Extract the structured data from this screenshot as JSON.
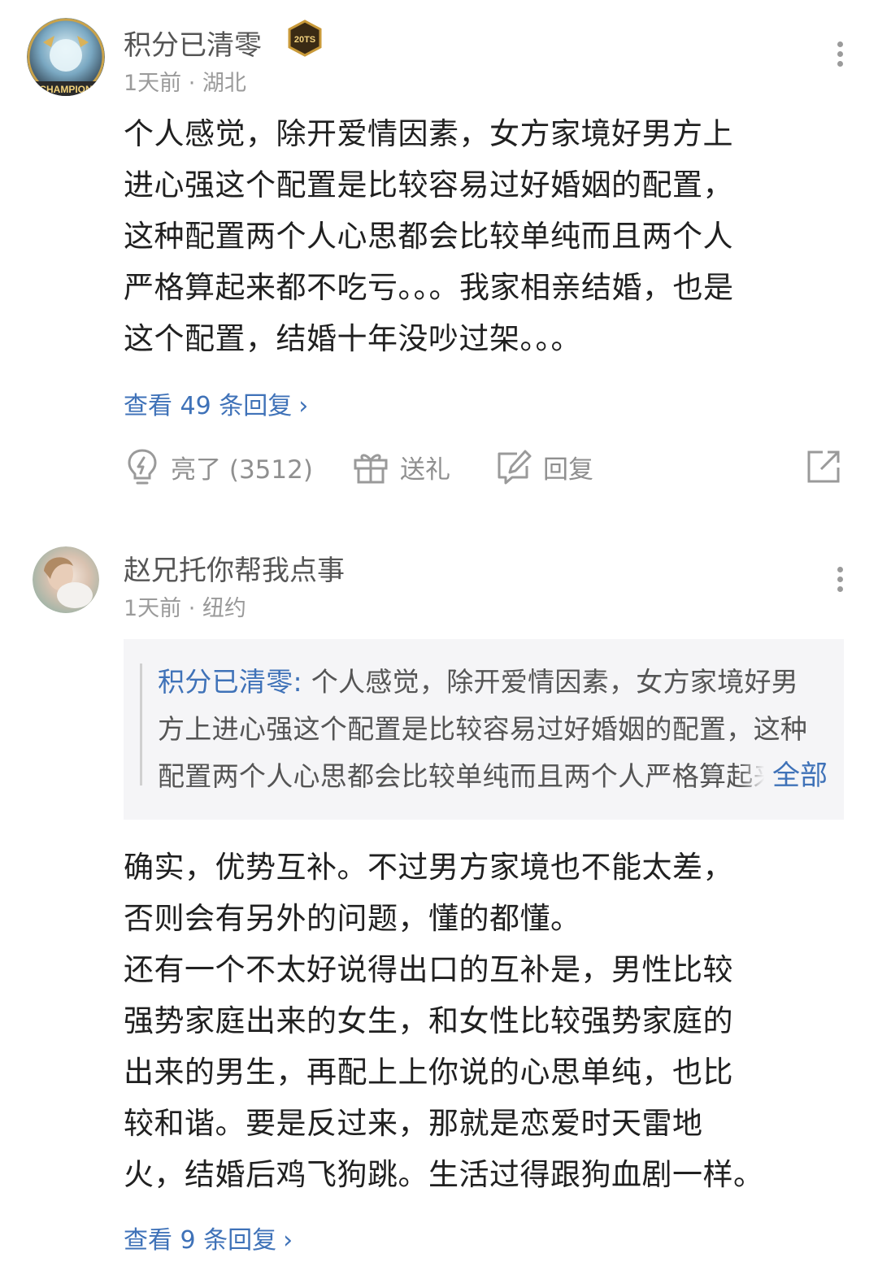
{
  "comments": [
    {
      "username": "积分已清零",
      "avatar_badge": "CHAMPION",
      "medal_text": "20TS",
      "meta": "1天前 · 湖北",
      "body": "个人感觉，除开爱情因素，女方家境好男方上\n进心强这个配置是比较容易过好婚姻的配置，\n这种配置两个人心思都会比较单纯而且两个人\n严格算起来都不吃亏。。。我家相亲结婚，也是\n这个配置，结婚十年没吵过架。。。",
      "view_replies": "查看 49 条回复",
      "actions": {
        "like": "亮了 (3512)",
        "gift": "送礼",
        "reply": "回复"
      },
      "icons": [
        "lightbulb-icon",
        "gift-icon",
        "edit-reply-icon",
        "share-icon",
        "more-icon"
      ]
    },
    {
      "username": "赵兄托你帮我点事",
      "meta": "1天前 · 纽约",
      "quote": {
        "author": "积分已清零:",
        "text": " 个人感觉，除开爱情因素，女方家境好男方上进心强这个配置是比较容易过好婚姻的配置，这种配置两个人心思都会比较单纯而且两个人严格算起来都不吃亏",
        "more_label": "全部"
      },
      "body": "确实，优势互补。不过男方家境也不能太差，\n否则会有另外的问题，懂的都懂。\n还有一个不太好说得出口的互补是，男性比较\n强势家庭出来的女生，和女性比较强势家庭的\n出来的男生，再配上上你说的心思单纯，也比\n较和谐。要是反过来，那就是恋爱时天雷地\n火，结婚后鸡飞狗跳。生活过得跟狗血剧一样。",
      "view_replies": "查看 9 条回复"
    }
  ],
  "colors": {
    "link": "#3f72b8",
    "meta": "#9a9a9a",
    "quote_bg": "#f5f5f7"
  }
}
